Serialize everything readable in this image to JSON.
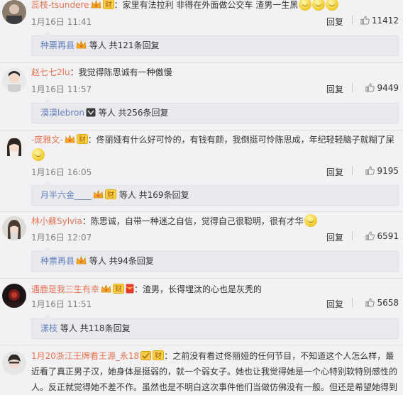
{
  "comments": [
    {
      "username": "蕊枝-tsundere",
      "text": "：家里有法拉利 非得在外面做公交车   渣男一生黑",
      "time": "1月16日 11:41",
      "reply_label": "回复",
      "likes": "11412",
      "replies": {
        "user": "种票再县",
        "text": "等人 共121条回复"
      }
    },
    {
      "username": "赵七七2lu",
      "text": "：我觉得陈思诚有一种傲慢",
      "time": "1月16日 11:57",
      "reply_label": "回复",
      "likes": "9449",
      "replies": {
        "user": "漠漠lebron",
        "text": "等人 共256条回复"
      }
    },
    {
      "username": "-庞雅文-",
      "text": "：佟丽娅有什么好可怜的，有钱有颜，我倒挺可怜陈思成，年纪轻轻脑子就糊了屎",
      "time": "1月16日 16:05",
      "reply_label": "回复",
      "likes": "9195",
      "replies": {
        "user": "月半六金____",
        "text": "等人 共169条回复"
      }
    },
    {
      "username": "林小蘇Sylvia",
      "text": "：陈思诚，自带一种迷之自信，觉得自己很聪明，很有才华",
      "time": "1月16日 12:07",
      "reply_label": "回复",
      "likes": "6591",
      "replies": {
        "user": "种票再县",
        "text": "等人 共94条回复"
      }
    },
    {
      "username": "遇鹿是我三生有幸",
      "text": "：渣男，长得埋汰的心也是灰秃的",
      "time": "1月16日 11:51",
      "reply_label": "回复",
      "likes": "5658",
      "replies": {
        "user": "漾枝",
        "text": "等人 共118条回复"
      }
    },
    {
      "username": "1月20浙江王牌看王源_永18",
      "text": "：之前没有看过佟丽娅的任何节目，不知道这个人怎么样，最近看了真正男子汉，她身体是挺弱的，就一个弱女子。她也让我觉得她是一个心特别软特别感性的人。反正就觉得她不差不作。虽然也是不明白这次事件他们当做仿佛没有一般。但还是希望她得到"
    }
  ],
  "colors": {
    "username": "#eb7350",
    "link": "#5f7fbd",
    "meta": "#808080"
  }
}
